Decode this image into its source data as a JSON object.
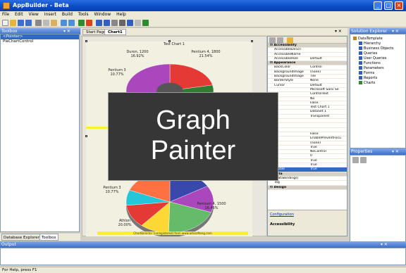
{
  "window": {
    "title": "AppBuilder - Beta",
    "min": "_",
    "max": "□",
    "close": "×"
  },
  "menu": [
    "File",
    "Edit",
    "View",
    "Insert",
    "Build",
    "Tools",
    "Window",
    "Help"
  ],
  "toolbox": {
    "title": "Toolbox",
    "controls": "▾ ✕",
    "items": [
      "<Pointer>",
      "PieChartControl"
    ],
    "tabs": [
      "Database Explorer",
      "Toolbox"
    ]
  },
  "doc": {
    "tabs": [
      "Start Page",
      "Chart1"
    ],
    "controls": "▾ ✕"
  },
  "chart": {
    "top_title": "Test Chart 1",
    "top_labels": [
      {
        "text": "Duron, 1200\n16.92%"
      },
      {
        "text": "Pentium 4, 1800\n21.54%"
      },
      {
        "text": "Pentium 3\n10.77%"
      }
    ],
    "bottom_labels": [
      {
        "text": "Pentium 3\n10.77%"
      },
      {
        "text": "Pentium 4, 1500\n16.46%"
      },
      {
        "text": "Athlon\n20.00%"
      }
    ],
    "footer": "ChartDirector (unregistered) from www.advsofteng.com",
    "colors": [
      "#e53935",
      "#2e7d32",
      "#3949ab",
      "#fdd835",
      "#ab47bc",
      "#26c6da",
      "#66bb6a",
      "#ff7043",
      "#ec407a"
    ]
  },
  "overlay": {
    "line1": "Graph",
    "line2": "Painter"
  },
  "properties": {
    "rows": [
      {
        "kind": "cat",
        "name": "Accessibility",
        "value": ""
      },
      {
        "kind": "row",
        "name": "AccessibleDescri",
        "value": ""
      },
      {
        "kind": "row",
        "name": "AccessibleName",
        "value": ""
      },
      {
        "kind": "row",
        "name": "AccessibleRole",
        "value": "Default"
      },
      {
        "kind": "cat",
        "name": "Appearance",
        "value": ""
      },
      {
        "kind": "row",
        "name": "BackColor",
        "value": "Control"
      },
      {
        "kind": "row",
        "name": "BackgroundImage",
        "value": "(none)"
      },
      {
        "kind": "row",
        "name": "BackgroundImage",
        "value": "Tile"
      },
      {
        "kind": "row",
        "name": "BorderStyle",
        "value": "None"
      },
      {
        "kind": "row",
        "name": "Cursor",
        "value": "Default"
      },
      {
        "kind": "row",
        "name": "",
        "value": "Microsoft Sans Se"
      },
      {
        "kind": "row",
        "name": "",
        "value": "ControlText"
      },
      {
        "kind": "row",
        "name": "",
        "value": "No"
      },
      {
        "kind": "row",
        "name": "",
        "value": "False"
      },
      {
        "kind": "row",
        "name": "",
        "value": "Test Chart 1"
      },
      {
        "kind": "row",
        "name": "",
        "value": "DataSet 1"
      },
      {
        "kind": "row",
        "name": "",
        "value": "Transparent"
      },
      {
        "kind": "row",
        "name": "",
        "value": ""
      },
      {
        "kind": "row",
        "name": "",
        "value": ""
      },
      {
        "kind": "row",
        "name": "",
        "value": ""
      },
      {
        "kind": "row",
        "name": "",
        "value": "False"
      },
      {
        "kind": "row",
        "name": "",
        "value": "EnablePreventFocu"
      },
      {
        "kind": "row",
        "name": "",
        "value": "(none)"
      },
      {
        "kind": "row",
        "name": "",
        "value": "True"
      },
      {
        "kind": "row",
        "name": "",
        "value": "NoControl"
      },
      {
        "kind": "row",
        "name": "",
        "value": "0"
      },
      {
        "kind": "row",
        "name": "",
        "value": "True"
      },
      {
        "kind": "row",
        "name": "",
        "value": "True"
      },
      {
        "kind": "sel",
        "name": "Visible",
        "value": "True"
      },
      {
        "kind": "cat",
        "name": "Data",
        "value": ""
      },
      {
        "kind": "row",
        "name": "(DataBindings)",
        "value": ""
      },
      {
        "kind": "row",
        "name": "Tag",
        "value": ""
      },
      {
        "kind": "cat",
        "name": "Design",
        "value": ""
      }
    ],
    "link": "Configuration",
    "desc_title": "Accessibility"
  },
  "solution": {
    "title": "Solution Explorer",
    "controls": "▾ ✕",
    "items": [
      {
        "label": "DataTemplate",
        "indent": 0,
        "color": "#c08020"
      },
      {
        "label": "Hierarchy",
        "indent": 1,
        "color": "#3060c0"
      },
      {
        "label": "Business Objects",
        "indent": 1,
        "color": "#3060c0"
      },
      {
        "label": "Queries",
        "indent": 1,
        "color": "#3060c0"
      },
      {
        "label": "User Queries",
        "indent": 1,
        "color": "#3060c0"
      },
      {
        "label": "Functions",
        "indent": 1,
        "color": "#3060c0"
      },
      {
        "label": "Parameters",
        "indent": 1,
        "color": "#3060c0"
      },
      {
        "label": "Forms",
        "indent": 1,
        "color": "#3060c0"
      },
      {
        "label": "Reports",
        "indent": 1,
        "color": "#3060c0"
      },
      {
        "label": "Charts",
        "indent": 1,
        "color": "#2e8b2e"
      }
    ]
  },
  "propswin": {
    "title": "Properties",
    "controls": "▾ ✕"
  },
  "output": {
    "title": "Output",
    "controls": "▾ ✕"
  },
  "status": "For Help, press F1"
}
